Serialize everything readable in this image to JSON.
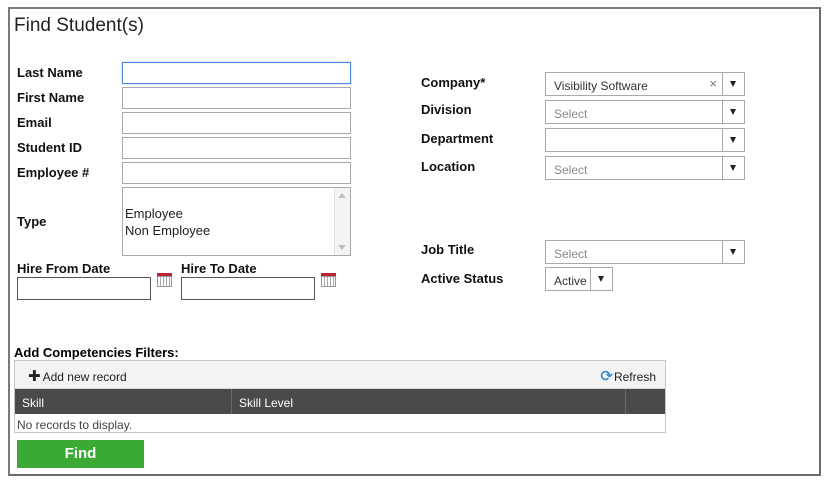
{
  "title": "Find Student(s)",
  "fields": {
    "last_name": {
      "label": "Last Name",
      "value": ""
    },
    "first_name": {
      "label": "First Name",
      "value": ""
    },
    "email": {
      "label": "Email",
      "value": ""
    },
    "student_id": {
      "label": "Student ID",
      "value": ""
    },
    "employee_no": {
      "label": "Employee #",
      "value": ""
    },
    "type": {
      "label": "Type",
      "options": [
        "Employee",
        "Non Employee"
      ]
    },
    "hire_from": {
      "label": "Hire From Date",
      "value": ""
    },
    "hire_to": {
      "label": "Hire To Date",
      "value": ""
    }
  },
  "right": {
    "company": {
      "label": "Company*",
      "value": "Visibility Software",
      "clear": "×"
    },
    "division": {
      "label": "Division",
      "placeholder": "Select"
    },
    "department": {
      "label": "Department",
      "placeholder": ""
    },
    "location": {
      "label": "Location",
      "placeholder": "Select"
    },
    "job_title": {
      "label": "Job Title",
      "placeholder": "Select"
    },
    "active_status": {
      "label": "Active Status",
      "value": "Active"
    }
  },
  "competencies": {
    "label": "Add Competencies Filters:",
    "add_label": "Add new record",
    "refresh_label": "Refresh",
    "columns": [
      "Skill",
      "Skill Level"
    ],
    "empty": "No records to display."
  },
  "find_label": "Find",
  "colors": {
    "find": "#3aaa35",
    "grid_header": "#4a4a4a",
    "focus": "#4d8ad6"
  },
  "icons": {
    "calendar": "calendar-icon",
    "add": "plus-icon",
    "refresh": "refresh-icon",
    "dropdown": "chevron-down-icon",
    "clear": "close-icon"
  }
}
